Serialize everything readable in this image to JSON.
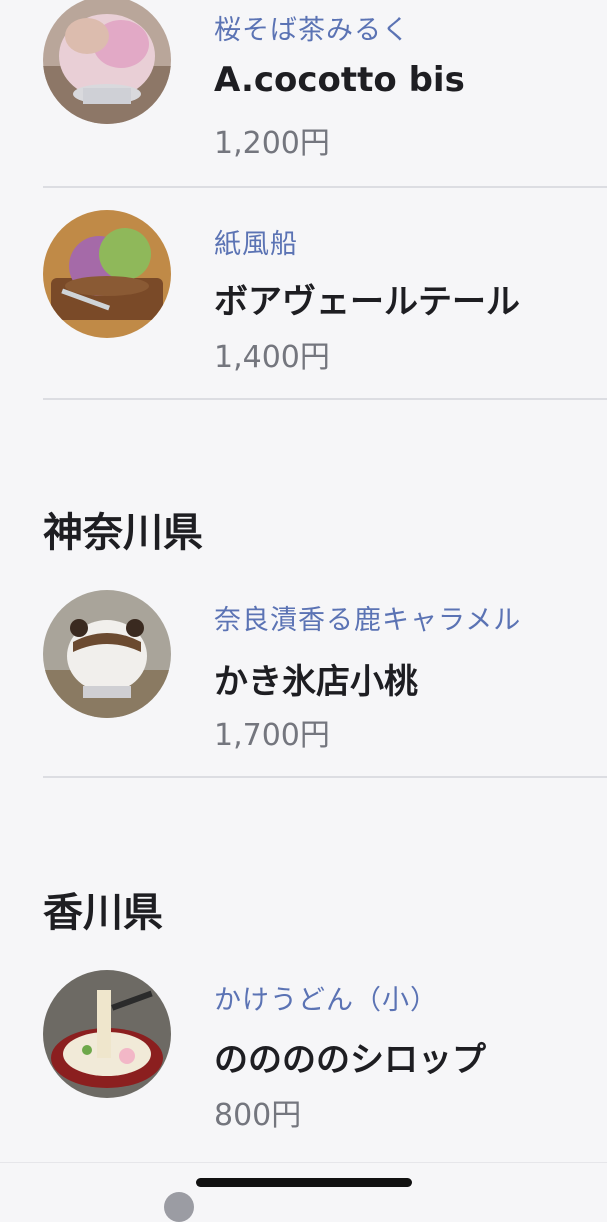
{
  "items_top": [
    {
      "shop": "桜そば茶みるく",
      "name": "A.cocotto bis",
      "price": "1,200円",
      "thumb_icon": "shaved-ice-pink-photo"
    },
    {
      "shop": "紙風船",
      "name": "ボアヴェールテール",
      "price": "1,400円",
      "thumb_icon": "shaved-ice-purple-matcha-photo"
    }
  ],
  "sections": [
    {
      "heading": "神奈川県",
      "items": [
        {
          "shop": "奈良漬香る鹿キャラメル",
          "name": "かき氷店小桃",
          "price": "1,700円",
          "thumb_icon": "shaved-ice-caramel-deer-photo"
        }
      ]
    },
    {
      "heading": "香川県",
      "items": [
        {
          "shop": "かけうどん（小）",
          "name": "ののののシロップ",
          "price": "800円",
          "thumb_icon": "udon-shaved-ice-photo"
        }
      ]
    }
  ],
  "colors": {
    "background": "#f6f6f8",
    "shop_text": "#5b73b4",
    "name_text": "#1e1e22",
    "price_text": "#74767e",
    "divider": "#dcdde2"
  }
}
